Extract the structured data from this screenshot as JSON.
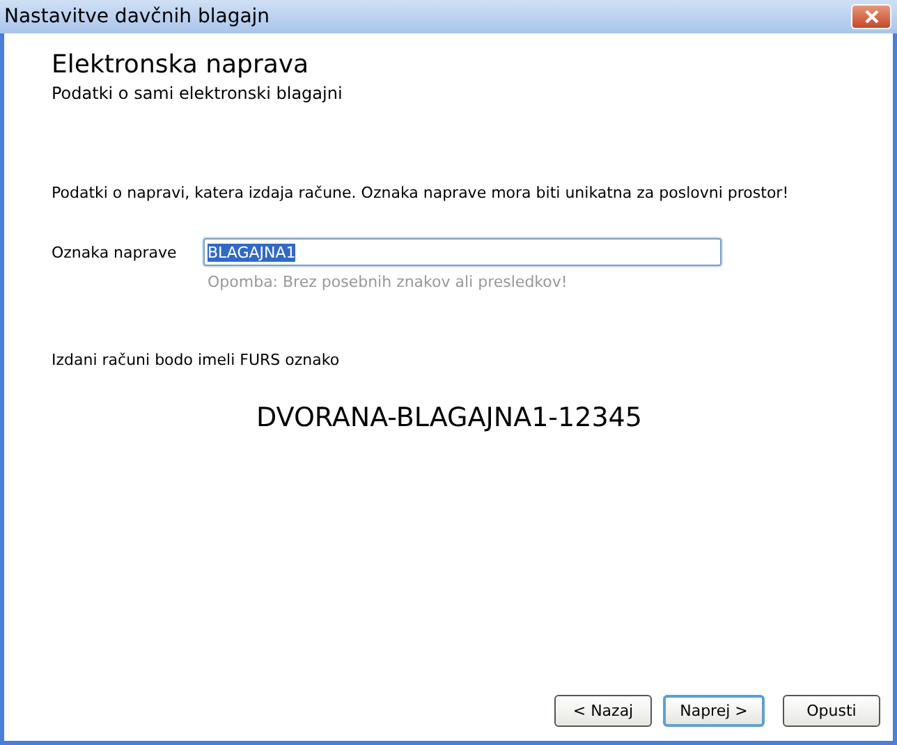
{
  "window": {
    "title": "Nastavitve davčnih blagajn"
  },
  "header": {
    "title": "Elektronska naprava",
    "subtitle": "Podatki o sami elektronski blagajni"
  },
  "description": "Podatki o napravi, katera izdaja račune. Oznaka naprave mora biti unikatna za poslovni prostor!",
  "field": {
    "label": "Oznaka naprave",
    "value": "BLAGAJNA1",
    "value_selected": true,
    "hint": "Opomba: Brez posebnih znakov ali presledkov!"
  },
  "preview": {
    "label": "Izdani računi bodo imeli FURS oznako",
    "code": "DVORANA-BLAGAJNA1-12345"
  },
  "buttons": [
    {
      "label": "< Nazaj",
      "default": false
    },
    {
      "label": "Naprej >",
      "default": true
    },
    {
      "label": "Opusti",
      "default": false
    }
  ]
}
